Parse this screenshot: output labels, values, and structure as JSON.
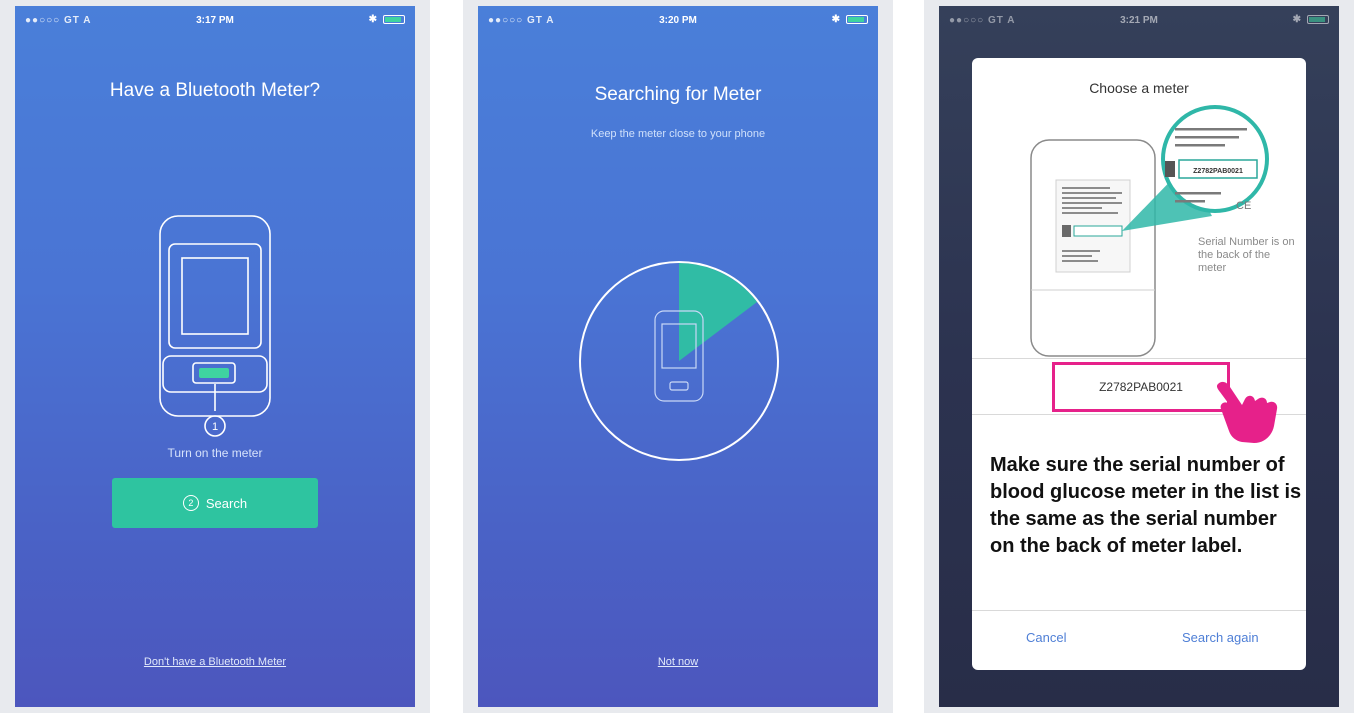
{
  "colors": {
    "accent_teal": "#2ec4a0",
    "highlight_pink": "#e6218a",
    "link_blue": "#4f7fd6"
  },
  "screens": [
    {
      "status": {
        "carrier": "●●○○○ GT A",
        "time": "3:17 PM"
      },
      "title": "Have a Bluetooth Meter?",
      "step_number": "1",
      "caption": "Turn on the meter",
      "search_button": {
        "step": "2",
        "label": "Search"
      },
      "bottom_link": "Don't have a Bluetooth Meter"
    },
    {
      "status": {
        "carrier": "●●○○○ GT A",
        "time": "3:20 PM"
      },
      "title": "Searching for Meter",
      "subtitle": "Keep the meter close to your phone",
      "bottom_link": "Not now"
    },
    {
      "status": {
        "carrier": "●●○○○ GT A",
        "time": "3:21 PM"
      },
      "dialog": {
        "title": "Choose a meter",
        "label_serial": "Z2782PAB0021",
        "serial_note": "Serial Number is on the back of the meter",
        "serial_value": "Z2782PAB0021",
        "instruction": "Make sure the serial number of blood glucose meter in the list is the same as the serial number on the back of meter label.",
        "cancel_label": "Cancel",
        "search_again_label": "Search again"
      }
    }
  ]
}
